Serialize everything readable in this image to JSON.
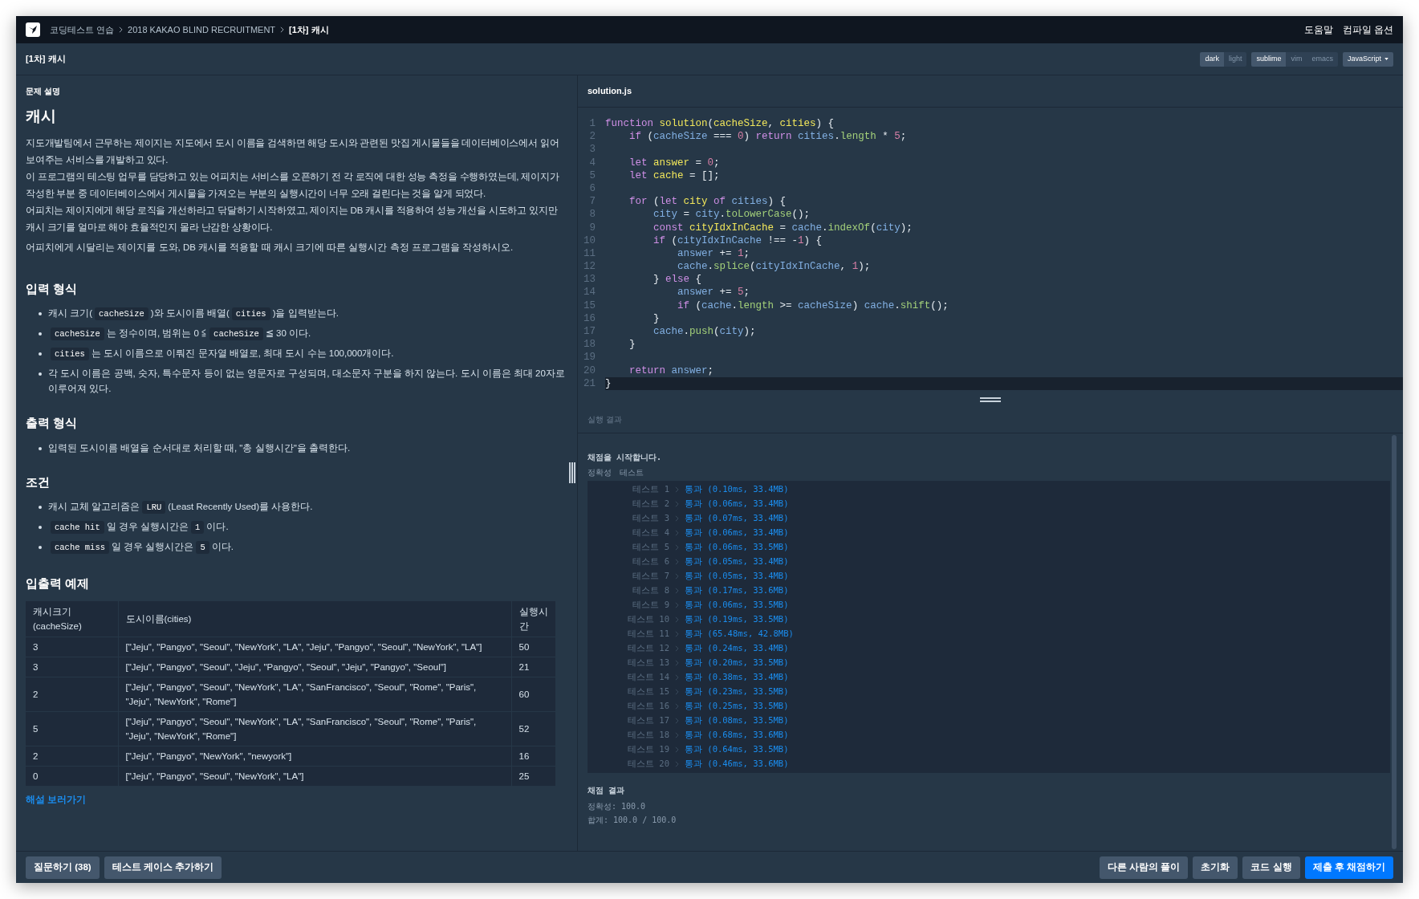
{
  "top_bar": {
    "breadcrumbs": [
      {
        "label": "코딩테스트 연습",
        "current": false
      },
      {
        "label": "2018 KAKAO BLIND RECRUITMENT",
        "current": false
      },
      {
        "label": "[1차] 캐시",
        "current": true
      }
    ],
    "links": [
      "도움말",
      "컴파일 옵션"
    ]
  },
  "title_bar": {
    "title": "[1차] 캐시",
    "themes": [
      {
        "label": "dark",
        "selected": true
      },
      {
        "label": "light",
        "selected": false
      }
    ],
    "keymaps": [
      {
        "label": "sublime",
        "selected": true
      },
      {
        "label": "vim",
        "selected": false
      },
      {
        "label": "emacs",
        "selected": false
      }
    ],
    "language": "JavaScript"
  },
  "problem": {
    "section_label": "문제 설명",
    "title": "캐시",
    "intro": [
      "지도개발팀에서 근무하는 제이지는 지도에서 도시 이름을 검색하면 해당 도시와 관련된 맛집 게시물들을 데이터베이스에서 읽어 보여주는 서비스를 개발하고 있다.",
      "이 프로그램의 테스팅 업무를 담당하고 있는 어피치는 서비스를 오픈하기 전 각 로직에 대한 성능 측정을 수행하였는데, 제이지가 작성한 부분 중 데이터베이스에서 게시물을 가져오는 부분의 실행시간이 너무 오래 걸린다는 것을 알게 되었다.",
      "어피치는 제이지에게 해당 로직을 개선하라고 닦달하기 시작하였고, 제이지는 DB 캐시를 적용하여 성능 개선을 시도하고 있지만 캐시 크기를 얼마로 해야 효율적인지 몰라 난감한 상황이다."
    ],
    "request": "어피치에게 시달리는 제이지를 도와, DB 캐시를 적용할 때 캐시 크기에 따른 실행시간 측정 프로그램을 작성하시오.",
    "sections": [
      {
        "heading": "입력 형식",
        "bullets": [
          [
            {
              "kind": "text",
              "text": "캐시 크기("
            },
            {
              "kind": "code",
              "text": "cacheSize"
            },
            {
              "kind": "text",
              "text": ")와 도시이름 배열("
            },
            {
              "kind": "code",
              "text": "cities"
            },
            {
              "kind": "text",
              "text": ")을 입력받는다."
            }
          ],
          [
            {
              "kind": "code",
              "text": "cacheSize"
            },
            {
              "kind": "text",
              "text": "는 정수이며, 범위는 0 ≦"
            },
            {
              "kind": "code",
              "text": "cacheSize"
            },
            {
              "kind": "text",
              "text": "≦ 30 이다."
            }
          ],
          [
            {
              "kind": "code",
              "text": "cities"
            },
            {
              "kind": "text",
              "text": "는 도시 이름으로 이뤄진 문자열 배열로, 최대 도시 수는 100,000개이다."
            }
          ],
          [
            {
              "kind": "text",
              "text": "각 도시 이름은 공백, 숫자, 특수문자 등이 없는 영문자로 구성되며, 대소문자 구분을 하지 않는다. 도시 이름은 최대 20자로 이루어져 있다."
            }
          ]
        ]
      },
      {
        "heading": "출력 형식",
        "bullets": [
          [
            {
              "kind": "text",
              "text": "입력된 도시이름 배열을 순서대로 처리할 때, \"총 실행시간\"을 출력한다."
            }
          ]
        ]
      },
      {
        "heading": "조건",
        "bullets": [
          [
            {
              "kind": "text",
              "text": "캐시 교체 알고리즘은"
            },
            {
              "kind": "code",
              "text": "LRU"
            },
            {
              "kind": "text",
              "text": "(Least Recently Used)를 사용한다."
            }
          ],
          [
            {
              "kind": "code",
              "text": "cache hit"
            },
            {
              "kind": "text",
              "text": "일 경우 실행시간은"
            },
            {
              "kind": "code",
              "text": "1"
            },
            {
              "kind": "text",
              "text": "이다."
            }
          ],
          [
            {
              "kind": "code",
              "text": "cache miss"
            },
            {
              "kind": "text",
              "text": "일 경우 실행시간은"
            },
            {
              "kind": "code",
              "text": "5"
            },
            {
              "kind": "text",
              "text": "이다."
            }
          ]
        ]
      }
    ],
    "examples": {
      "heading": "입출력 예제",
      "columns": [
        "캐시크기(cacheSize)",
        "도시이름(cities)",
        "실행시간"
      ],
      "rows": [
        [
          "3",
          "[\"Jeju\", \"Pangyo\", \"Seoul\", \"NewYork\", \"LA\", \"Jeju\", \"Pangyo\", \"Seoul\", \"NewYork\", \"LA\"]",
          "50"
        ],
        [
          "3",
          "[\"Jeju\", \"Pangyo\", \"Seoul\", \"Jeju\", \"Pangyo\", \"Seoul\", \"Jeju\", \"Pangyo\", \"Seoul\"]",
          "21"
        ],
        [
          "2",
          "[\"Jeju\", \"Pangyo\", \"Seoul\", \"NewYork\", \"LA\", \"SanFrancisco\", \"Seoul\", \"Rome\", \"Paris\", \"Jeju\", \"NewYork\", \"Rome\"]",
          "60"
        ],
        [
          "5",
          "[\"Jeju\", \"Pangyo\", \"Seoul\", \"NewYork\", \"LA\", \"SanFrancisco\", \"Seoul\", \"Rome\", \"Paris\", \"Jeju\", \"NewYork\", \"Rome\"]",
          "52"
        ],
        [
          "2",
          "[\"Jeju\", \"Pangyo\", \"NewYork\", \"newyork\"]",
          "16"
        ],
        [
          "0",
          "[\"Jeju\", \"Pangyo\", \"Seoul\", \"NewYork\", \"LA\"]",
          "25"
        ]
      ]
    },
    "explanation_link": "해설 보러가기"
  },
  "editor": {
    "filename": "solution.js",
    "lines": [
      {
        "n": "1",
        "current": false,
        "tokens": [
          {
            "kind": "kw",
            "text": "function "
          },
          {
            "kind": "def",
            "text": "solution"
          },
          {
            "kind": "p",
            "text": "("
          },
          {
            "kind": "def",
            "text": "cacheSize"
          },
          {
            "kind": "p",
            "text": ", "
          },
          {
            "kind": "def",
            "text": "cities"
          },
          {
            "kind": "p",
            "text": ") {"
          }
        ]
      },
      {
        "n": "2",
        "current": false,
        "tokens": [
          {
            "kind": "kw",
            "text": "    if"
          },
          {
            "kind": "p",
            "text": " ("
          },
          {
            "kind": "var",
            "text": "cacheSize"
          },
          {
            "kind": "p",
            "text": " === "
          },
          {
            "kind": "num",
            "text": "0"
          },
          {
            "kind": "p",
            "text": ") "
          },
          {
            "kind": "kw",
            "text": "return "
          },
          {
            "kind": "var",
            "text": "cities"
          },
          {
            "kind": "p",
            "text": "."
          },
          {
            "kind": "prop",
            "text": "length"
          },
          {
            "kind": "p",
            "text": " * "
          },
          {
            "kind": "num",
            "text": "5"
          },
          {
            "kind": "p",
            "text": ";"
          }
        ]
      },
      {
        "n": "3",
        "current": false
      },
      {
        "n": "4",
        "current": false,
        "tokens": [
          {
            "kind": "kw",
            "text": "    let "
          },
          {
            "kind": "def",
            "text": "answer"
          },
          {
            "kind": "p",
            "text": " = "
          },
          {
            "kind": "num",
            "text": "0"
          },
          {
            "kind": "p",
            "text": ";"
          }
        ]
      },
      {
        "n": "5",
        "current": false,
        "tokens": [
          {
            "kind": "kw",
            "text": "    let "
          },
          {
            "kind": "def",
            "text": "cache"
          },
          {
            "kind": "p",
            "text": " = [];"
          }
        ]
      },
      {
        "n": "6",
        "current": false
      },
      {
        "n": "7",
        "current": false,
        "tokens": [
          {
            "kind": "kw",
            "text": "    for"
          },
          {
            "kind": "p",
            "text": " ("
          },
          {
            "kind": "kw",
            "text": "let "
          },
          {
            "kind": "def",
            "text": "city "
          },
          {
            "kind": "kw",
            "text": "of "
          },
          {
            "kind": "var",
            "text": "cities"
          },
          {
            "kind": "p",
            "text": ") {"
          }
        ]
      },
      {
        "n": "8",
        "current": false,
        "tokens": [
          {
            "kind": "var",
            "text": "        city"
          },
          {
            "kind": "p",
            "text": " = "
          },
          {
            "kind": "var",
            "text": "city"
          },
          {
            "kind": "p",
            "text": "."
          },
          {
            "kind": "prop",
            "text": "toLowerCase"
          },
          {
            "kind": "p",
            "text": "();"
          }
        ]
      },
      {
        "n": "9",
        "current": false,
        "tokens": [
          {
            "kind": "kw",
            "text": "        const "
          },
          {
            "kind": "def",
            "text": "cityIdxInCache"
          },
          {
            "kind": "p",
            "text": " = "
          },
          {
            "kind": "var",
            "text": "cache"
          },
          {
            "kind": "p",
            "text": "."
          },
          {
            "kind": "prop",
            "text": "indexOf"
          },
          {
            "kind": "p",
            "text": "("
          },
          {
            "kind": "var",
            "text": "city"
          },
          {
            "kind": "p",
            "text": ");"
          }
        ]
      },
      {
        "n": "10",
        "current": false,
        "tokens": [
          {
            "kind": "kw",
            "text": "        if"
          },
          {
            "kind": "p",
            "text": " ("
          },
          {
            "kind": "var",
            "text": "cityIdxInCache"
          },
          {
            "kind": "p",
            "text": " !== -"
          },
          {
            "kind": "num",
            "text": "1"
          },
          {
            "kind": "p",
            "text": ") {"
          }
        ]
      },
      {
        "n": "11",
        "current": false,
        "tokens": [
          {
            "kind": "var",
            "text": "            answer"
          },
          {
            "kind": "p",
            "text": " += "
          },
          {
            "kind": "num",
            "text": "1"
          },
          {
            "kind": "p",
            "text": ";"
          }
        ]
      },
      {
        "n": "12",
        "current": false,
        "tokens": [
          {
            "kind": "var",
            "text": "            cache"
          },
          {
            "kind": "p",
            "text": "."
          },
          {
            "kind": "prop",
            "text": "splice"
          },
          {
            "kind": "p",
            "text": "("
          },
          {
            "kind": "var",
            "text": "cityIdxInCache"
          },
          {
            "kind": "p",
            "text": ", "
          },
          {
            "kind": "num",
            "text": "1"
          },
          {
            "kind": "p",
            "text": ");"
          }
        ]
      },
      {
        "n": "13",
        "current": false,
        "tokens": [
          {
            "kind": "p",
            "text": "        } "
          },
          {
            "kind": "kw",
            "text": "else"
          },
          {
            "kind": "p",
            "text": " {"
          }
        ]
      },
      {
        "n": "14",
        "current": false,
        "tokens": [
          {
            "kind": "var",
            "text": "            answer"
          },
          {
            "kind": "p",
            "text": " += "
          },
          {
            "kind": "num",
            "text": "5"
          },
          {
            "kind": "p",
            "text": ";"
          }
        ]
      },
      {
        "n": "15",
        "current": false,
        "tokens": [
          {
            "kind": "kw",
            "text": "            if"
          },
          {
            "kind": "p",
            "text": " ("
          },
          {
            "kind": "var",
            "text": "cache"
          },
          {
            "kind": "p",
            "text": "."
          },
          {
            "kind": "prop",
            "text": "length"
          },
          {
            "kind": "p",
            "text": " >= "
          },
          {
            "kind": "var",
            "text": "cacheSize"
          },
          {
            "kind": "p",
            "text": ") "
          },
          {
            "kind": "var",
            "text": "cache"
          },
          {
            "kind": "p",
            "text": "."
          },
          {
            "kind": "prop",
            "text": "shift"
          },
          {
            "kind": "p",
            "text": "();"
          }
        ]
      },
      {
        "n": "16",
        "current": false,
        "tokens": [
          {
            "kind": "p",
            "text": "        }"
          }
        ]
      },
      {
        "n": "17",
        "current": false,
        "tokens": [
          {
            "kind": "var",
            "text": "        cache"
          },
          {
            "kind": "p",
            "text": "."
          },
          {
            "kind": "prop",
            "text": "push"
          },
          {
            "kind": "p",
            "text": "("
          },
          {
            "kind": "var",
            "text": "city"
          },
          {
            "kind": "p",
            "text": ");"
          }
        ]
      },
      {
        "n": "18",
        "current": false,
        "tokens": [
          {
            "kind": "p",
            "text": "    }"
          }
        ]
      },
      {
        "n": "19",
        "current": false
      },
      {
        "n": "20",
        "current": false,
        "tokens": [
          {
            "kind": "kw",
            "text": "    return "
          },
          {
            "kind": "var",
            "text": "answer"
          },
          {
            "kind": "p",
            "text": ";"
          }
        ]
      },
      {
        "n": "21",
        "current": true,
        "tokens": [
          {
            "kind": "p",
            "text": "}"
          }
        ]
      }
    ]
  },
  "output": {
    "heading": "실행 결과",
    "start_message": "채점을 시작합니다.",
    "group_labels": [
      "정확성",
      "테스트"
    ],
    "tests": [
      {
        "label": "테스트 1",
        "status": "통과",
        "detail": "(0.10ms, 33.4MB)"
      },
      {
        "label": "테스트 2",
        "status": "통과",
        "detail": "(0.06ms, 33.4MB)"
      },
      {
        "label": "테스트 3",
        "status": "통과",
        "detail": "(0.07ms, 33.4MB)"
      },
      {
        "label": "테스트 4",
        "status": "통과",
        "detail": "(0.06ms, 33.4MB)"
      },
      {
        "label": "테스트 5",
        "status": "통과",
        "detail": "(0.06ms, 33.5MB)"
      },
      {
        "label": "테스트 6",
        "status": "통과",
        "detail": "(0.05ms, 33.4MB)"
      },
      {
        "label": "테스트 7",
        "status": "통과",
        "detail": "(0.05ms, 33.4MB)"
      },
      {
        "label": "테스트 8",
        "status": "통과",
        "detail": "(0.17ms, 33.6MB)"
      },
      {
        "label": "테스트 9",
        "status": "통과",
        "detail": "(0.06ms, 33.5MB)"
      },
      {
        "label": "테스트 10",
        "status": "통과",
        "detail": "(0.19ms, 33.5MB)"
      },
      {
        "label": "테스트 11",
        "status": "통과",
        "detail": "(65.48ms, 42.8MB)"
      },
      {
        "label": "테스트 12",
        "status": "통과",
        "detail": "(0.24ms, 33.4MB)"
      },
      {
        "label": "테스트 13",
        "status": "통과",
        "detail": "(0.20ms, 33.5MB)"
      },
      {
        "label": "테스트 14",
        "status": "통과",
        "detail": "(0.38ms, 33.4MB)"
      },
      {
        "label": "테스트 15",
        "status": "통과",
        "detail": "(0.23ms, 33.5MB)"
      },
      {
        "label": "테스트 16",
        "status": "통과",
        "detail": "(0.25ms, 33.5MB)"
      },
      {
        "label": "테스트 17",
        "status": "통과",
        "detail": "(0.08ms, 33.5MB)"
      },
      {
        "label": "테스트 18",
        "status": "통과",
        "detail": "(0.68ms, 33.6MB)"
      },
      {
        "label": "테스트 19",
        "status": "통과",
        "detail": "(0.64ms, 33.5MB)"
      },
      {
        "label": "테스트 20",
        "status": "통과",
        "detail": "(0.46ms, 33.6MB)"
      }
    ],
    "summary_heading": "채점 결과",
    "summary_lines": [
      "정확성: 100.0",
      "합계: 100.0 / 100.0"
    ]
  },
  "bottom_bar": {
    "left_buttons": [
      "질문하기 (38)",
      "테스트 케이스 추가하기"
    ],
    "right_buttons": [
      {
        "label": "다른 사람의 풀이",
        "primary": false
      },
      {
        "label": "초기화",
        "primary": false
      },
      {
        "label": "코드 실행",
        "primary": false
      },
      {
        "label": "제출 후 채점하기",
        "primary": true
      }
    ]
  }
}
